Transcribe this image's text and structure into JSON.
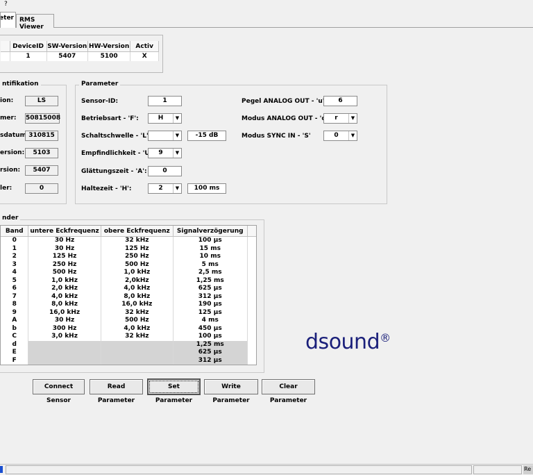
{
  "menu": {
    "help": "?"
  },
  "tabs": [
    {
      "label": "meter"
    },
    {
      "label": "RMS Viewer"
    }
  ],
  "device_table": {
    "headers": [
      "DeviceID",
      "SW-Version",
      "HW-Version",
      "Activ"
    ],
    "row": [
      "1",
      "5407",
      "5100",
      "X"
    ]
  },
  "identification": {
    "title": "ntifikation",
    "rows": [
      {
        "label": "ion:",
        "value": "LS"
      },
      {
        "label": "mer:",
        "value": "50815008"
      },
      {
        "label": "sdatum:",
        "value": "310815"
      },
      {
        "label": "ersion:",
        "value": "5103"
      },
      {
        "label": "rsion:",
        "value": "5407"
      },
      {
        "label": "ler:",
        "value": "0"
      }
    ]
  },
  "parameter": {
    "title": "Parameter",
    "sensor_id": {
      "label": "Sensor-ID:",
      "value": "1"
    },
    "betriebsart": {
      "label": "Betriebsart - 'F':",
      "value": "H"
    },
    "schaltschwelle": {
      "label": "Schaltschwelle - 'L':",
      "value": "",
      "extra": "-15 dB"
    },
    "empfindlichkeit": {
      "label": "Empfindlichkeit - 'U':",
      "value": "9"
    },
    "glaettungszeit": {
      "label": "Glättungszeit - 'A':",
      "value": "0"
    },
    "haltezeit": {
      "label": "Haltezeit - 'H':",
      "value": "2",
      "extra": "100 ms"
    },
    "pegel_analog_out": {
      "label": "Pegel ANALOG OUT - 'u':",
      "value": "6"
    },
    "modus_analog_out": {
      "label": "Modus ANALOG OUT - 'o':",
      "value": "r"
    },
    "modus_sync_in": {
      "label": "Modus SYNC IN - 'S'",
      "value": "0"
    }
  },
  "baender": {
    "title": "nder",
    "headers": [
      "Band",
      "untere Eckfrequenz",
      "obere Eckfrequenz",
      "Signalverzögerung"
    ],
    "rows": [
      [
        "0",
        "30 Hz",
        "32 kHz",
        "100 µs"
      ],
      [
        "1",
        "30 Hz",
        "125 Hz",
        "15 ms"
      ],
      [
        "2",
        "125 Hz",
        "250 Hz",
        "10 ms"
      ],
      [
        "3",
        "250 Hz",
        "500 Hz",
        "5 ms"
      ],
      [
        "4",
        "500 Hz",
        "1,0 kHz",
        "2,5 ms"
      ],
      [
        "5",
        "1,0 kHz",
        "2,0kHz",
        "1,25 ms"
      ],
      [
        "6",
        "2,0 kHz",
        "4,0 kHz",
        "625 µs"
      ],
      [
        "7",
        "4,0 kHz",
        "8,0 kHz",
        "312 µs"
      ],
      [
        "8",
        "8,0 kHz",
        "16,0 kHz",
        "190 µs"
      ],
      [
        "9",
        "16,0 kHz",
        "32 kHz",
        "125 µs"
      ],
      [
        "A",
        "30 Hz",
        "500 Hz",
        "4 ms"
      ],
      [
        "b",
        "300 Hz",
        "4,0 kHz",
        "450 µs"
      ],
      [
        "C",
        "3,0 kHz",
        "32 kHz",
        "100 µs"
      ],
      [
        "d",
        "",
        "",
        "1,25 ms"
      ],
      [
        "E",
        "",
        "",
        "625 µs"
      ],
      [
        "F",
        "",
        "",
        "312 µs"
      ]
    ]
  },
  "buttons": {
    "connect": "Connect Sensor",
    "read": "Read Parameter",
    "set": "Set Parameter",
    "write": "Write Parameter",
    "clear": "Clear Parameter"
  },
  "logo": {
    "ds": "ds",
    "ound": "ound",
    "reg": "®"
  },
  "statusbar": {
    "right": "Re"
  }
}
